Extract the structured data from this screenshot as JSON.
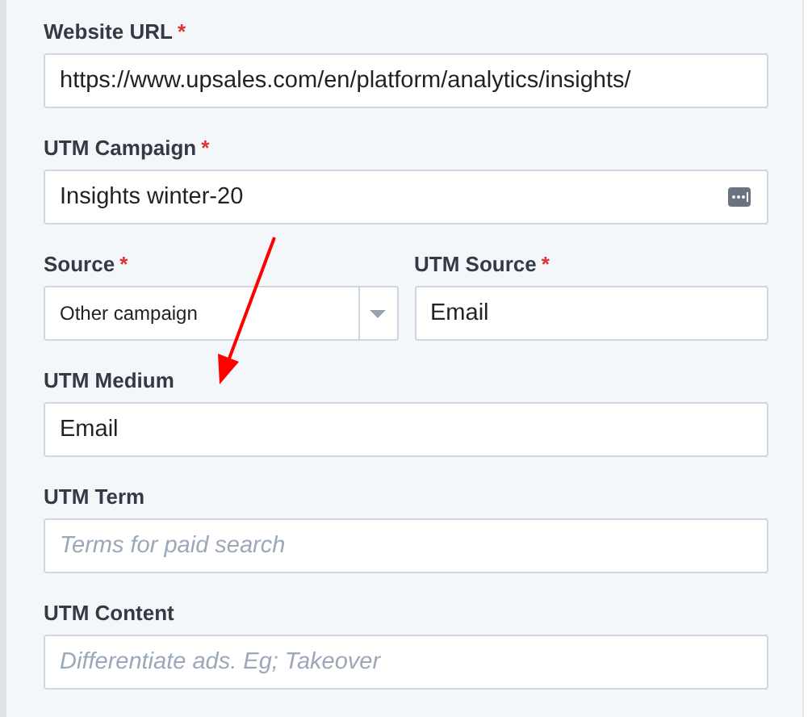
{
  "form_rows": [
    [
      {
        "label": "Website URL",
        "required_mark": "*",
        "kind": "input",
        "value": "https://www.upsales.com/en/platform/analytics/insights/"
      }
    ],
    [
      {
        "label": "UTM Campaign",
        "required_mark": "*",
        "kind": "input-menu",
        "value": "Insights winter-20"
      }
    ],
    [
      {
        "label": "Source",
        "required_mark": "*",
        "kind": "select",
        "value": "Other campaign"
      },
      {
        "label": "UTM Source",
        "required_mark": "*",
        "kind": "input",
        "value": "Email"
      }
    ],
    [
      {
        "label": "UTM Medium",
        "kind": "input",
        "value": "Email"
      }
    ],
    [
      {
        "label": "UTM Term",
        "kind": "input",
        "placeholder": "Terms for paid search"
      }
    ],
    [
      {
        "label": "UTM Content",
        "kind": "input",
        "placeholder": "Differentiate ads. Eg; Takeover"
      }
    ]
  ]
}
